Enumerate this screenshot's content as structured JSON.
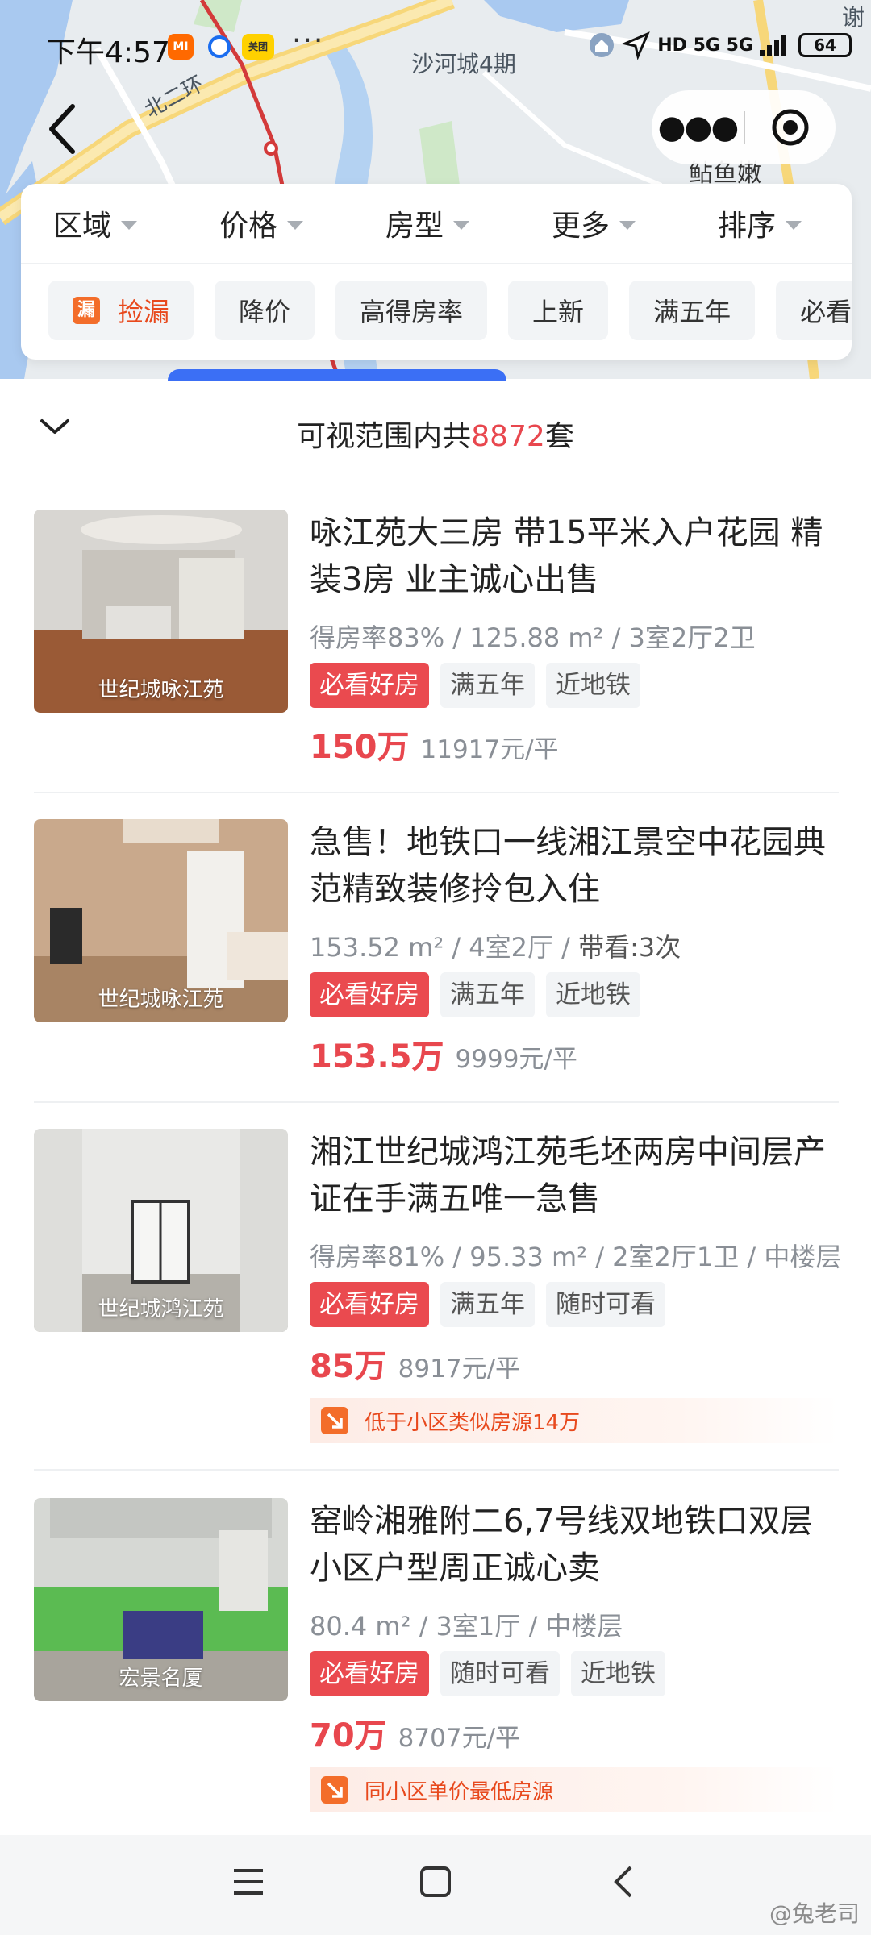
{
  "status_bar": {
    "time": "下午4:57",
    "app_icon_1": "MI",
    "app_icon_3": "美团",
    "dots": "···",
    "network": "HD 5G 5G",
    "battery": "64"
  },
  "map": {
    "labels": [
      "沙河城4期",
      "北二环",
      "鲇鱼嫩",
      "谢"
    ],
    "icon_names": [
      "home-pin-icon",
      "location-arrow-icon",
      "metro-line"
    ]
  },
  "nav": {
    "back_icon": "chevron-left-icon",
    "more_icon": "more-dots-icon",
    "target_icon": "target-icon"
  },
  "filters": [
    "区域",
    "价格",
    "房型",
    "更多",
    "排序"
  ],
  "tags": [
    "捡漏",
    "降价",
    "高得房率",
    "上新",
    "满五年",
    "必看"
  ],
  "tag_first_icon_text": "漏",
  "summary": {
    "prefix": "可视范围内共",
    "count": "8872",
    "suffix": "套"
  },
  "listings": [
    {
      "caption": "世纪城咏江苑",
      "title": "咏江苑大三房 带15平米入户花园 精装3房 业主诚心出售",
      "meta": "得房率83% / 125.88 m² / 3室2厅2卫",
      "badges": [
        "必看好房",
        "满五年",
        "近地铁"
      ],
      "price": "150万",
      "unit_price": "11917元/平"
    },
    {
      "caption": "世纪城咏江苑",
      "title": "急售！地铁口一线湘江景空中花园典范精致装修拎包入住",
      "meta_plain": "153.52 m² / 4室2厅 / ",
      "meta_hl": "带看:3次",
      "badges": [
        "必看好房",
        "满五年",
        "近地铁"
      ],
      "price": "153.5万",
      "unit_price": "9999元/平"
    },
    {
      "caption": "世纪城鸿江苑",
      "title": "湘江世纪城鸿江苑毛坯两房中间层产证在手满五唯一急售",
      "meta": "得房率81% / 95.33 m² / 2室2厅1卫 / 中楼层",
      "badges": [
        "必看好房",
        "满五年",
        "随时可看"
      ],
      "price": "85万",
      "unit_price": "8917元/平",
      "insight": "低于小区类似房源14万"
    },
    {
      "caption": "宏景名厦",
      "title": "窑岭湘雅附二6,7号线双地铁口双层小区户型周正诚心卖",
      "meta": "80.4 m² / 3室1厅 / 中楼层",
      "badges": [
        "必看好房",
        "随时可看",
        "近地铁"
      ],
      "price": "70万",
      "unit_price": "8707元/平",
      "insight": "同小区单价最低房源"
    }
  ],
  "bottom_nav": {
    "menu_icon": "menu-icon",
    "home_icon": "home-square-icon",
    "back_icon": "back-chevron-icon"
  },
  "watermark": "@兔老司",
  "colors": {
    "accent_red": "#e8474e",
    "badge_red": "#ea4a4f",
    "orange": "#f36d2a",
    "blue_handle": "#3b6ff5"
  }
}
